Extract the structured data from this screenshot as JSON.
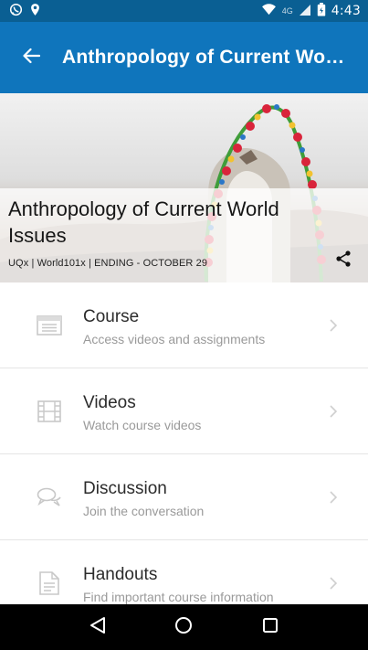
{
  "status_bar": {
    "time": "4:43",
    "network_label": "4G",
    "icons": [
      "whatsapp-icon",
      "location-pin-icon",
      "wifi-icon",
      "signal-icon",
      "battery-icon"
    ]
  },
  "app_bar": {
    "title": "Anthropology of Current World Issues",
    "back_icon": "arrow-left-icon"
  },
  "hero": {
    "title": "Anthropology of Current World Issues",
    "meta": "UQx | World101x | ENDING - OCTOBER 29",
    "share_icon": "share-icon"
  },
  "menu": {
    "items": [
      {
        "title": "Course",
        "subtitle": "Access videos and assignments",
        "icon": "course-list-icon"
      },
      {
        "title": "Videos",
        "subtitle": "Watch course videos",
        "icon": "film-icon"
      },
      {
        "title": "Discussion",
        "subtitle": "Join the conversation",
        "icon": "chat-bubbles-icon"
      },
      {
        "title": "Handouts",
        "subtitle": "Find important course information",
        "icon": "document-icon"
      }
    ]
  },
  "nav_bar": {
    "buttons": [
      "back-triangle-icon",
      "home-circle-icon",
      "recents-square-icon"
    ]
  },
  "colors": {
    "status_bar": "#0a5f93",
    "app_bar": "#0f75bc",
    "title_text": "#2c2c2c",
    "subtitle_text": "#9a9a9a",
    "divider": "#e5e5e5"
  }
}
